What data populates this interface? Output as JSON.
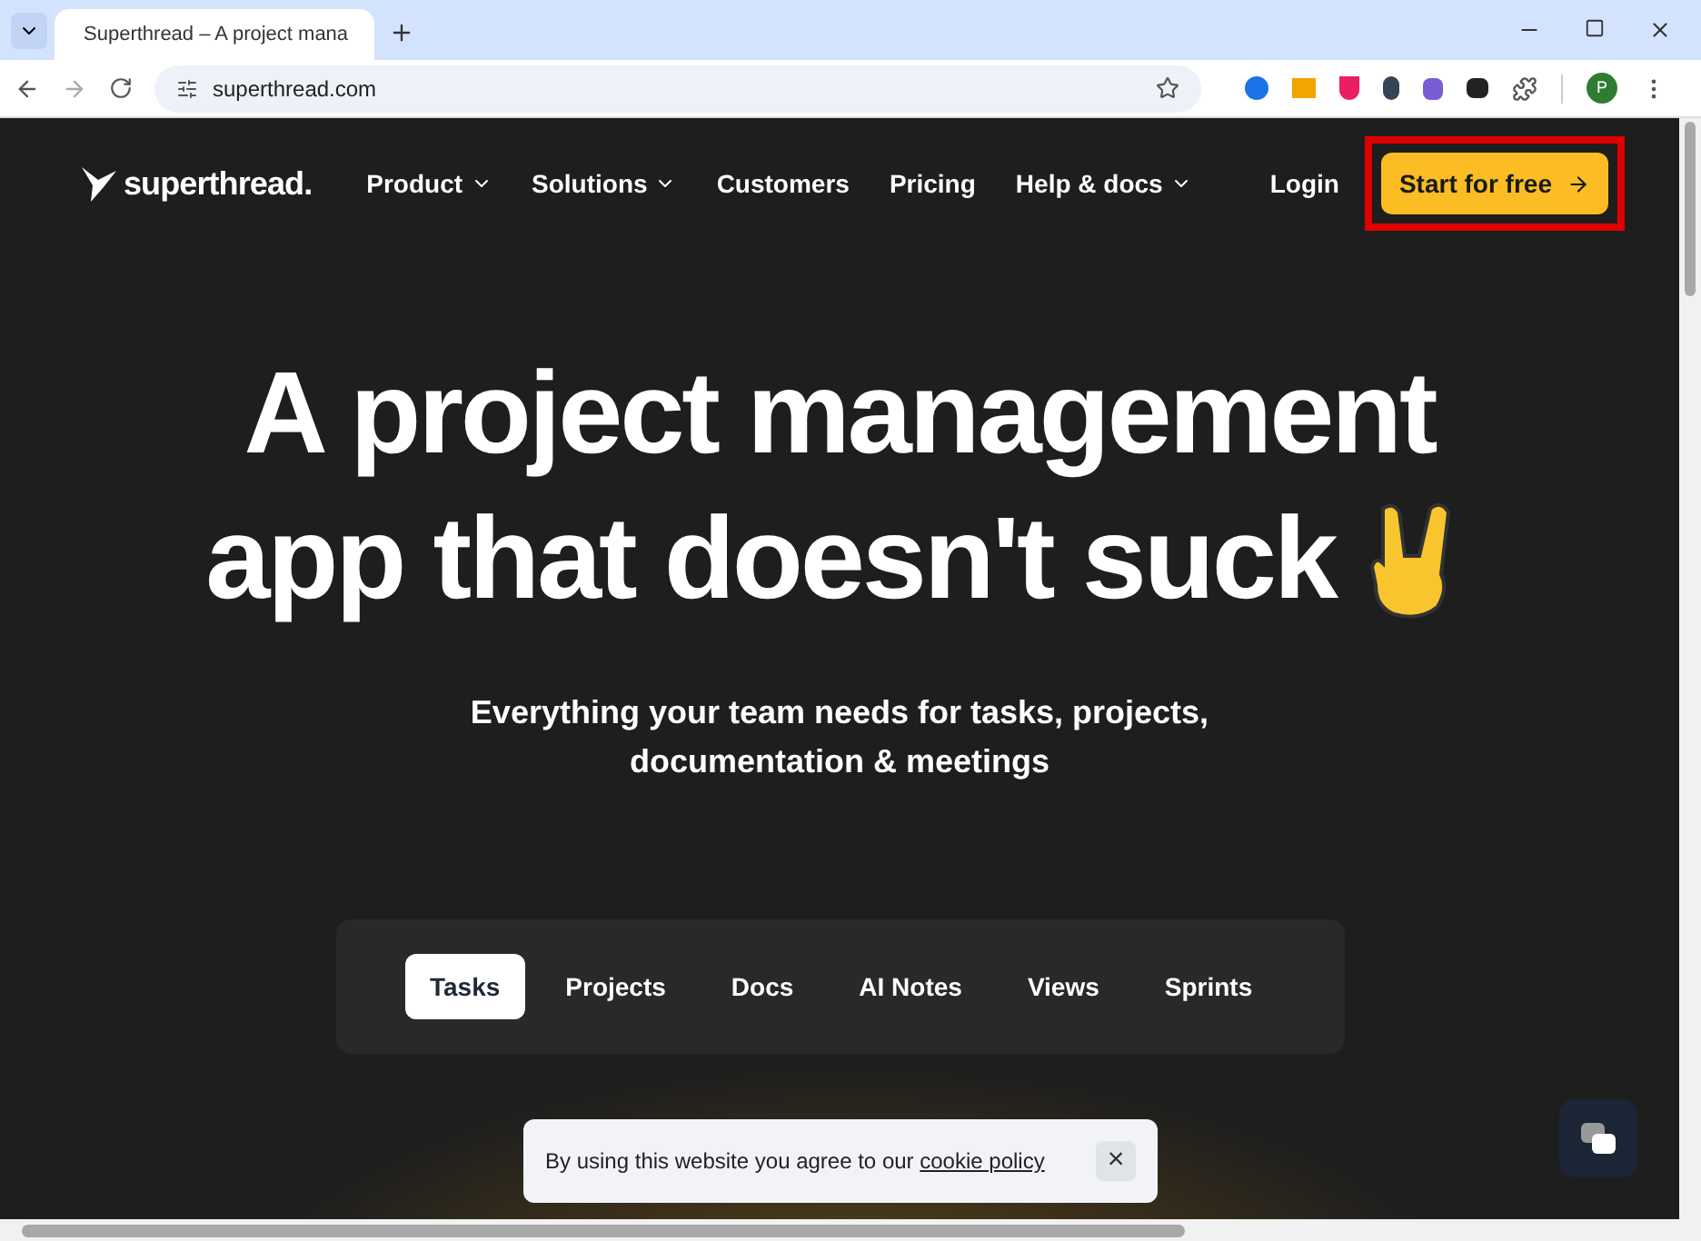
{
  "browser": {
    "tab_title": "Superthread – A project mana",
    "url": "superthread.com",
    "profile_initial": "P"
  },
  "nav": {
    "logo": "superthread.",
    "items": [
      {
        "label": "Product",
        "dropdown": true
      },
      {
        "label": "Solutions",
        "dropdown": true
      },
      {
        "label": "Customers",
        "dropdown": false
      },
      {
        "label": "Pricing",
        "dropdown": false
      },
      {
        "label": "Help & docs",
        "dropdown": true
      }
    ],
    "login": "Login",
    "cta": "Start for free",
    "cta_highlighted": true
  },
  "hero": {
    "headline_lines": [
      "A project management",
      "app that doesn't suck"
    ],
    "subtitle_lines": [
      "Everything your team needs for tasks, projects,",
      "documentation & meetings"
    ]
  },
  "tabs": [
    {
      "label": "Tasks",
      "selected": true
    },
    {
      "label": "Projects",
      "selected": false
    },
    {
      "label": "Docs",
      "selected": false
    },
    {
      "label": "AI Notes",
      "selected": false
    },
    {
      "label": "Views",
      "selected": false
    },
    {
      "label": "Sprints",
      "selected": false
    }
  ],
  "cookie": {
    "text": "By using this website you agree to our",
    "link": "cookie policy",
    "close": "×"
  }
}
